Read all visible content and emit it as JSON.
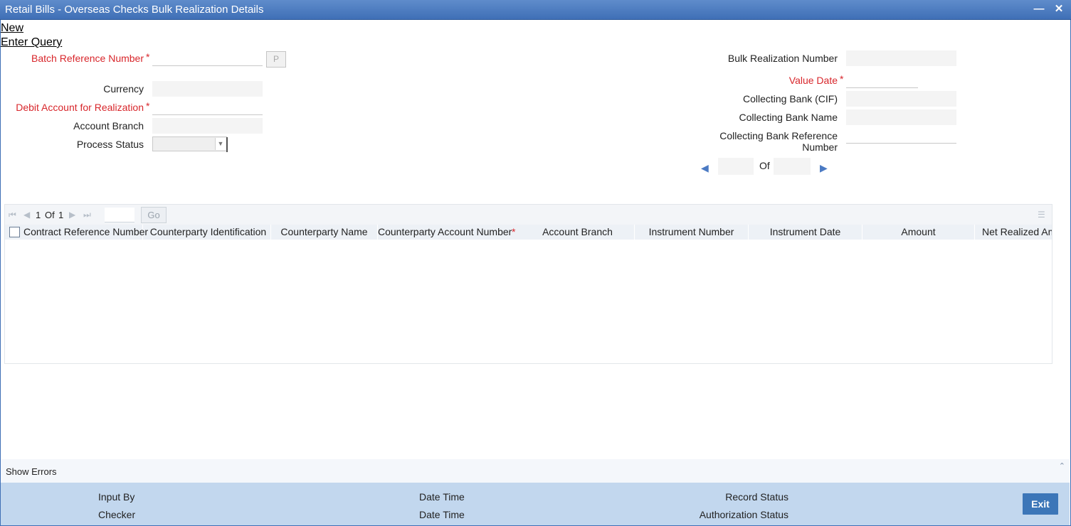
{
  "window": {
    "title": "Retail Bills - Overseas Checks Bulk Realization Details",
    "minimize": "—",
    "close": "✕"
  },
  "menu": {
    "new": "New",
    "enter_query": "Enter Query"
  },
  "form": {
    "batch_ref_label": "Batch Reference Number",
    "p_button": "P",
    "currency_label": "Currency",
    "debit_account_label": "Debit Account for Realization",
    "account_branch_label": "Account Branch",
    "process_status_label": "Process Status",
    "bulk_realization_label": "Bulk Realization Number",
    "value_date_label": "Value Date",
    "collecting_bank_cif_label": "Collecting Bank (CIF)",
    "collecting_bank_name_label": "Collecting Bank Name",
    "collecting_bank_ref_label_1": "Collecting Bank Reference",
    "collecting_bank_ref_label_2": "Number",
    "required_mark": "*",
    "of_label": "Of"
  },
  "grid": {
    "page_current": "1",
    "page_of": "Of",
    "page_total": "1",
    "go_label": "Go",
    "columns": [
      "Contract Reference Number",
      "Counterparty Identification",
      "Counterparty Name",
      "Counterparty Account Number",
      "Account Branch",
      "Instrument Number",
      "Instrument Date",
      "Amount",
      "Net Realized Am"
    ],
    "required_mark": "*"
  },
  "errors": {
    "label": "Show Errors"
  },
  "footer": {
    "input_by": "Input By",
    "checker": "Checker",
    "date_time_1": "Date Time",
    "date_time_2": "Date Time",
    "record_status": "Record Status",
    "authorization_status": "Authorization Status",
    "exit": "Exit"
  }
}
